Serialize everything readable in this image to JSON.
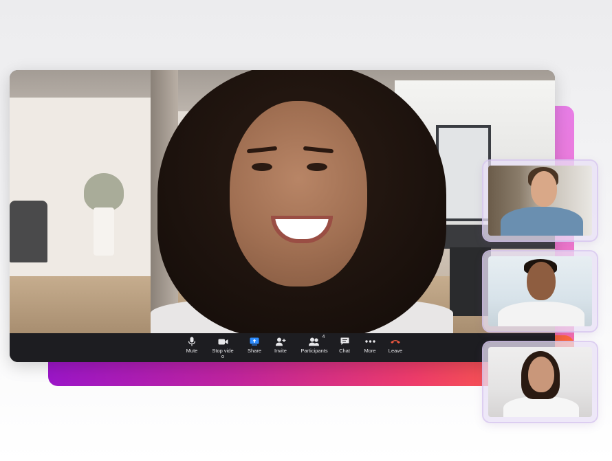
{
  "controls": [
    {
      "id": "mute",
      "label": "Mute",
      "icon": "microphone-icon"
    },
    {
      "id": "stop-video",
      "label": "Stop video",
      "icon": "video-camera-icon"
    },
    {
      "id": "share",
      "label": "Share",
      "icon": "share-screen-icon"
    },
    {
      "id": "invite",
      "label": "Invite",
      "icon": "add-person-icon"
    },
    {
      "id": "participants",
      "label": "Participants",
      "icon": "participants-icon",
      "count": "4"
    },
    {
      "id": "chat",
      "label": "Chat",
      "icon": "chat-bubble-icon"
    },
    {
      "id": "more",
      "label": "More",
      "icon": "more-dots-icon"
    },
    {
      "id": "leave",
      "label": "Leave",
      "icon": "hang-up-icon"
    }
  ],
  "colors": {
    "control_bar": "#1d1d21",
    "share_accent": "#2d8cff",
    "leave_accent": "#e8563f",
    "gradient_start": "#9b16c8",
    "gradient_end": "#ff6a3a"
  }
}
